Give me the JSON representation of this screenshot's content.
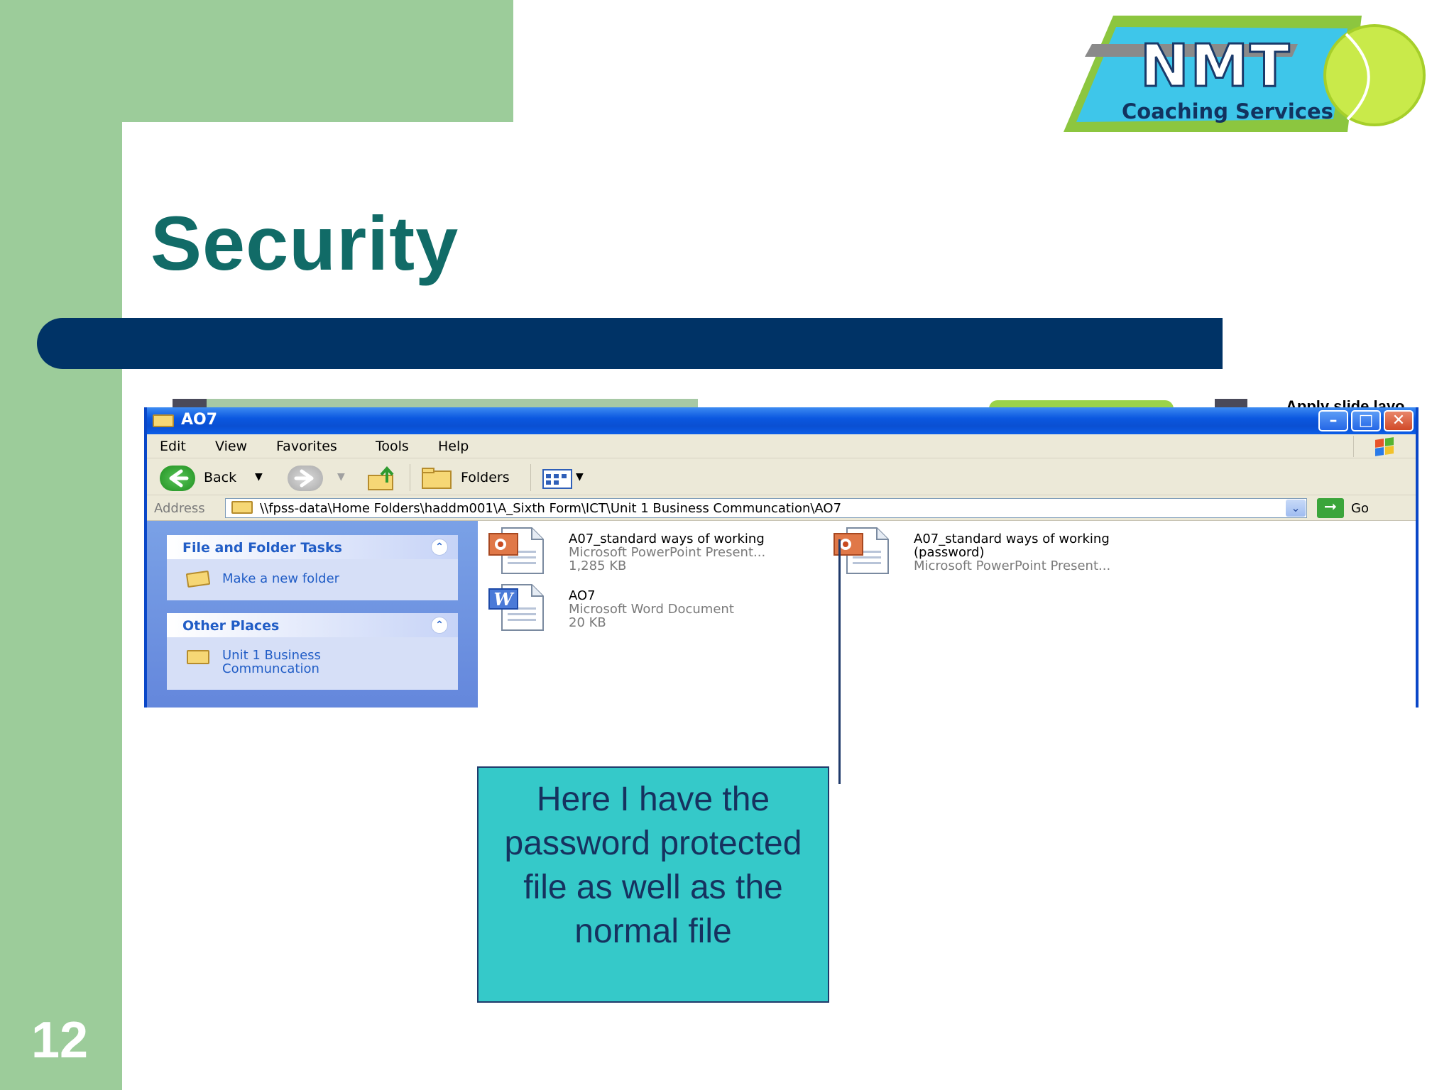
{
  "slide": {
    "number": "12",
    "title": "Security"
  },
  "logo": {
    "text": "NMT",
    "subtitle": "Coaching Services"
  },
  "crop_strip_text": "Apply slide layo",
  "window": {
    "title": "AO7",
    "menu": [
      "Edit",
      "View",
      "Favorites",
      "Tools",
      "Help"
    ],
    "toolbar": {
      "back_label": "Back",
      "folders_label": "Folders"
    },
    "address": {
      "label": "Address",
      "value": "\\\\fpss-data\\Home Folders\\haddm001\\A_Sixth Form\\ICT\\Unit 1 Business Communcation\\AO7",
      "go_label": "Go"
    },
    "tasks": {
      "header": "File and Folder Tasks",
      "items": [
        "Make a new folder"
      ]
    },
    "other_places": {
      "header": "Other Places",
      "items": [
        [
          "Unit 1 Business",
          "Communcation"
        ]
      ]
    },
    "files": [
      {
        "name": "A07_standard ways of working",
        "type": "Microsoft PowerPoint Present...",
        "size": "1,285 KB",
        "icon": "powerpoint-file-icon"
      },
      {
        "name": "AO7",
        "type": "Microsoft Word Document",
        "size": "20 KB",
        "icon": "word-file-icon"
      },
      {
        "name": "A07_standard ways of working",
        "name2": "(password)",
        "type": "Microsoft PowerPoint Present...",
        "icon": "powerpoint-file-icon"
      }
    ]
  },
  "callout": {
    "lines": [
      "Here I have the",
      "password protected",
      "file as well as the",
      "normal file"
    ]
  },
  "colors": {
    "green": "#9ccc9a",
    "title": "#116b67",
    "navy_bar": "#003366",
    "callout_fill": "#35c9c9",
    "xp_blue": "#0a4fd2"
  }
}
